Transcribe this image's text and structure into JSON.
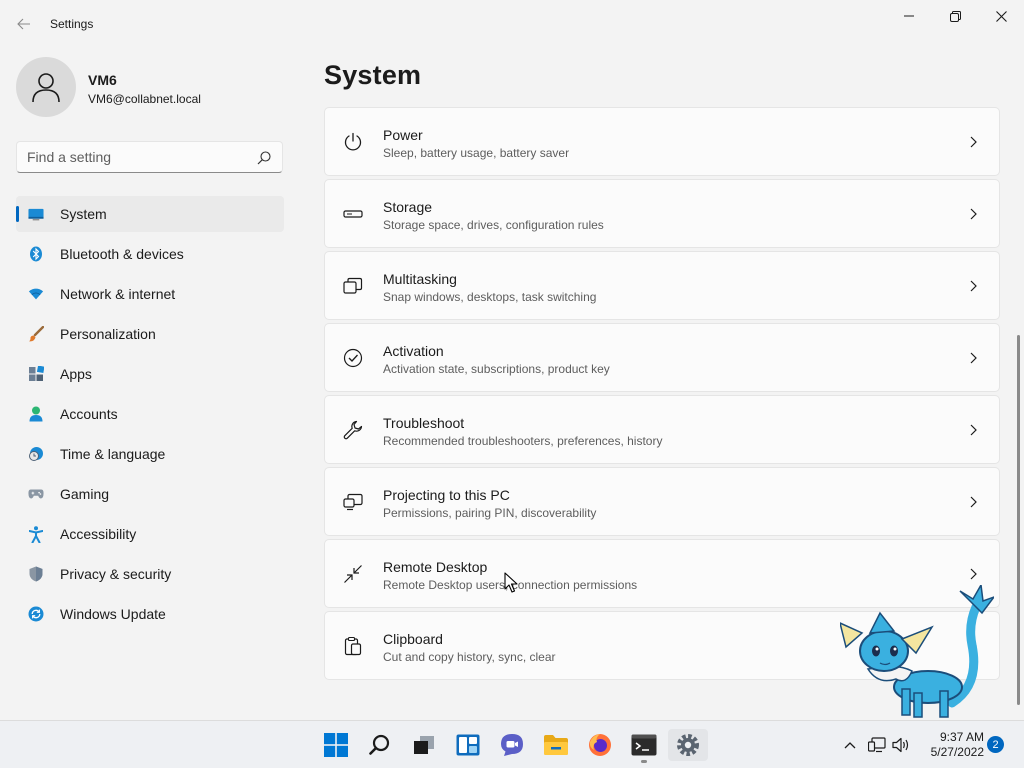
{
  "window": {
    "title": "Settings",
    "back_icon": "back-arrow-icon",
    "minimize_icon": "minimize-icon",
    "maximize_icon": "restore-icon",
    "close_icon": "close-icon"
  },
  "profile": {
    "name": "VM6",
    "email": "VM6@collabnet.local"
  },
  "search": {
    "placeholder": "Find a setting",
    "value": ""
  },
  "sidebar": {
    "items": [
      {
        "label": "System",
        "icon": "system-monitor-icon",
        "active": true
      },
      {
        "label": "Bluetooth & devices",
        "icon": "bluetooth-icon"
      },
      {
        "label": "Network & internet",
        "icon": "wifi-icon"
      },
      {
        "label": "Personalization",
        "icon": "paintbrush-icon"
      },
      {
        "label": "Apps",
        "icon": "apps-grid-icon"
      },
      {
        "label": "Accounts",
        "icon": "person-icon"
      },
      {
        "label": "Time & language",
        "icon": "globe-clock-icon"
      },
      {
        "label": "Gaming",
        "icon": "gamepad-icon"
      },
      {
        "label": "Accessibility",
        "icon": "accessibility-person-icon"
      },
      {
        "label": "Privacy & security",
        "icon": "shield-icon"
      },
      {
        "label": "Windows Update",
        "icon": "sync-update-icon"
      }
    ]
  },
  "main": {
    "title": "System",
    "cards": [
      {
        "title": "Power",
        "subtitle": "Sleep, battery usage, battery saver",
        "icon": "power-icon"
      },
      {
        "title": "Storage",
        "subtitle": "Storage space, drives, configuration rules",
        "icon": "storage-drive-icon"
      },
      {
        "title": "Multitasking",
        "subtitle": "Snap windows, desktops, task switching",
        "icon": "multitasking-icon"
      },
      {
        "title": "Activation",
        "subtitle": "Activation state, subscriptions, product key",
        "icon": "check-circle-icon"
      },
      {
        "title": "Troubleshoot",
        "subtitle": "Recommended troubleshooters, preferences, history",
        "icon": "wrench-icon"
      },
      {
        "title": "Projecting to this PC",
        "subtitle": "Permissions, pairing PIN, discoverability",
        "icon": "projection-icon"
      },
      {
        "title": "Remote Desktop",
        "subtitle": "Remote Desktop users, connection permissions",
        "icon": "remote-desktop-icon"
      },
      {
        "title": "Clipboard",
        "subtitle": "Cut and copy history, sync, clear",
        "icon": "clipboard-icon"
      }
    ]
  },
  "taskbar": {
    "apps": [
      {
        "name": "Start",
        "icon": "windows-start-icon"
      },
      {
        "name": "Search",
        "icon": "taskbar-search-icon"
      },
      {
        "name": "Task View",
        "icon": "task-view-icon"
      },
      {
        "name": "Widgets",
        "icon": "widgets-icon"
      },
      {
        "name": "Chat",
        "icon": "chat-icon"
      },
      {
        "name": "File Explorer",
        "icon": "folder-icon"
      },
      {
        "name": "Firefox",
        "icon": "firefox-icon"
      },
      {
        "name": "Terminal",
        "icon": "terminal-icon"
      },
      {
        "name": "Settings",
        "icon": "settings-gear-icon"
      }
    ],
    "tray": {
      "time": "9:37 AM",
      "date": "5/27/2022",
      "notification_count": "2"
    }
  },
  "colors": {
    "accent": "#0067c0",
    "window_bg": "#f3f3f3",
    "card_bg": "#fbfbfb",
    "sidebar_active_bg": "#eaeaea"
  }
}
